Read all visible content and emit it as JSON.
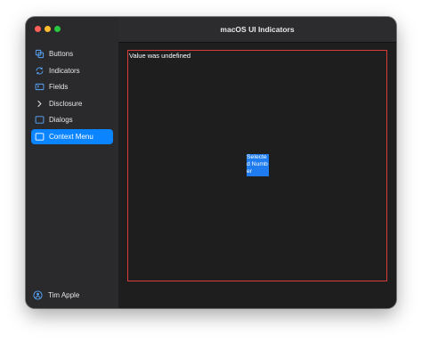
{
  "window": {
    "title": "macOS UI Indicators"
  },
  "sidebar": {
    "items": [
      {
        "label": "Buttons",
        "icon": "buttons-icon"
      },
      {
        "label": "Indicators",
        "icon": "refresh-icon"
      },
      {
        "label": "Fields",
        "icon": "text-field-icon"
      },
      {
        "label": "Disclosure",
        "icon": "chevron-right-icon"
      },
      {
        "label": "Dialogs",
        "icon": "dialog-icon"
      },
      {
        "label": "Context Menu",
        "icon": "context-menu-icon",
        "selected": true
      }
    ],
    "user": {
      "name": "Tim Apple",
      "icon": "person-icon"
    }
  },
  "main": {
    "status_text": "Value was undefined",
    "selected_tile_text": "Selected Number"
  },
  "colors": {
    "accent": "#0a84ff",
    "debug_border": "#d83b3b"
  }
}
